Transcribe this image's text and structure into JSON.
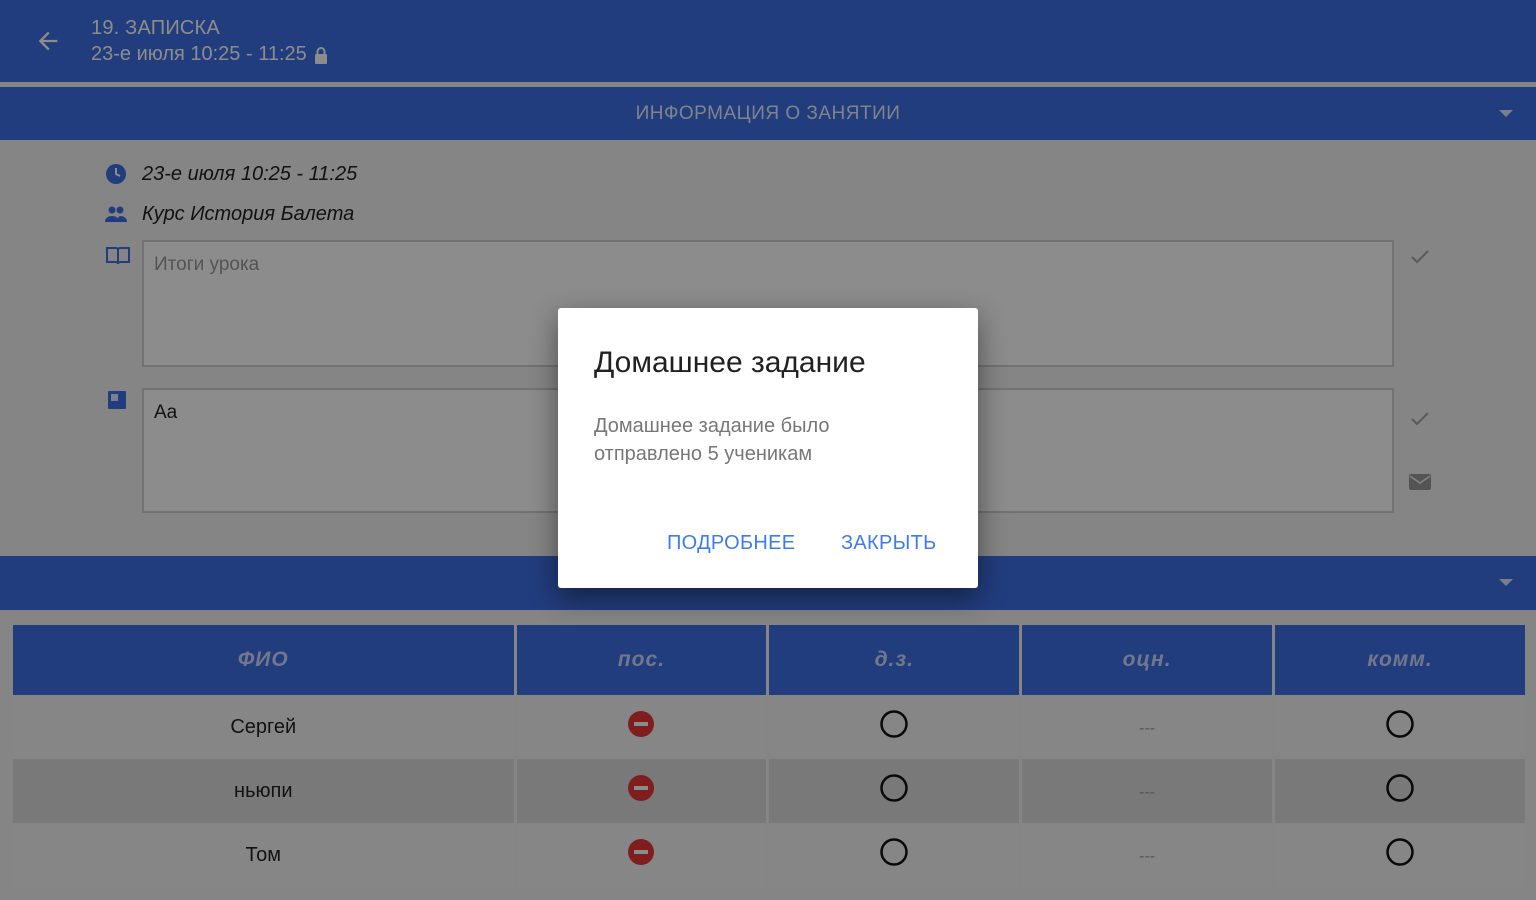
{
  "appbar": {
    "title": "19. ЗАПИСКА",
    "subtitle": "23-е июля 10:25 - 11:25"
  },
  "lesson_info_header": "ИНФОРМАЦИЯ О ЗАНЯТИИ",
  "lesson": {
    "datetime": "23-е июля 10:25 - 11:25",
    "course": "Курс История Балета",
    "summary_placeholder": "Итоги урока",
    "homework_value": "Aa"
  },
  "table": {
    "headers": [
      "ФИО",
      "пос.",
      "д.з.",
      "оцн.",
      "комм."
    ],
    "rows": [
      {
        "name": "Сергей",
        "grade": "---"
      },
      {
        "name": "ньюпи",
        "grade": "---"
      },
      {
        "name": "Том",
        "grade": "---"
      }
    ]
  },
  "dialog": {
    "title": "Домашнее задание",
    "message": "Домашнее задание было отправлено 5 ученикам",
    "details_label": "ПОДРОБНЕЕ",
    "close_label": "ЗАКРЫТЬ"
  },
  "colors": {
    "primary": "#3f6fe3",
    "absent_red": "#e53935",
    "dialog_button": "#3d7cf0"
  },
  "icons": {
    "back": "arrow-left-icon",
    "lock": "lock-icon",
    "clock": "clock-icon",
    "group": "group-icon",
    "book": "book-icon",
    "homework": "notebook-icon",
    "check": "check-icon",
    "mail": "mail-icon",
    "chevron": "chevron-down-icon",
    "absent": "minus-circle-icon",
    "empty": "circle-outline-icon"
  }
}
